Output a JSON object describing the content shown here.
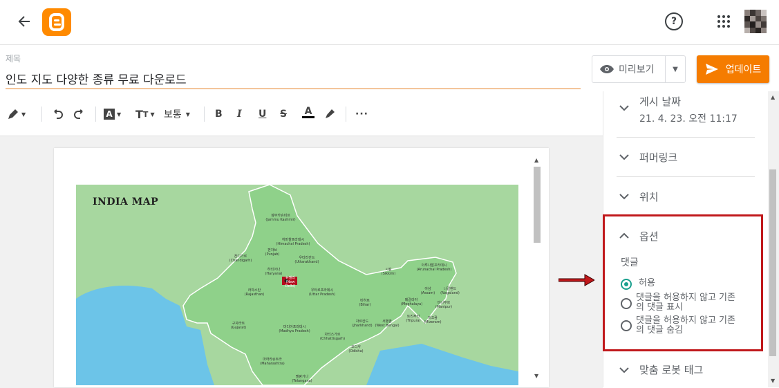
{
  "header": {
    "back_icon": "back-arrow-icon",
    "logo_icon": "blogger-logo-icon",
    "help_symbol": "?",
    "apps_icon": "apps-grid-icon",
    "avatar_icon": "user-avatar-icon",
    "brand_color": "#ff8a00"
  },
  "post": {
    "title_label": "제목",
    "title_value": "인도 지도 다양한 종류 무료 다운로드"
  },
  "actions": {
    "preview_label": "미리보기",
    "update_label": "업데이트",
    "update_color": "#f57c00"
  },
  "toolbar": {
    "paragraph_style": "보통"
  },
  "editor": {
    "map_title": "INDIA MAP",
    "map_labels": [
      "잠무카슈미르",
      "(Jammu Kashmir)",
      "히마찰프라데시",
      "(Himachal Pradesh)",
      "펀자브",
      "(Punjab)",
      "찬디가르",
      "(Chandigarh)",
      "우타라칸드",
      "(Uttarakhand)",
      "하리아나",
      "(Haryana)",
      "뉴델리",
      "(New Delhi)",
      "라자스탄",
      "(Rajasthan)",
      "우타르프라데시",
      "(Uttar Pradesh)",
      "비하르",
      "(Bihar)",
      "시킴",
      "(Sikkim)",
      "아루나찰프라데시",
      "(Arunachal Pradesh)",
      "아삼",
      "(Assam)",
      "나갈랜드",
      "(Nagaland)",
      "메갈라야",
      "(Meghalaya)",
      "마니푸르",
      "(Manipur)",
      "자르칸드",
      "(Jharkhand)",
      "서벵골",
      "(West Bengal)",
      "트리푸라",
      "(Tripura)",
      "미조람",
      "(Mizoram)",
      "구자라트",
      "(Gujarat)",
      "마디아프라데시",
      "(Madhya Pradesh)",
      "차티스가르",
      "(Chhattisgarh)",
      "오디샤",
      "(Odisha)",
      "마하라슈트라",
      "(Maharashtra)",
      "텔랑가나",
      "(Telangana)"
    ]
  },
  "sidebar": {
    "publish_title": "게시 날짜",
    "publish_value": "21. 4. 23. 오전 11:17",
    "permalink_title": "퍼머링크",
    "location_title": "위치",
    "options_title": "옵션",
    "comments_label": "댓글",
    "comment_options": [
      {
        "line1": "허용",
        "line2": "",
        "selected": true
      },
      {
        "line1": "댓글을 허용하지 않고 기존",
        "line2": "의 댓글 표시",
        "selected": false
      },
      {
        "line1": "댓글을 허용하지 않고 기존",
        "line2": "의 댓글 숨김",
        "selected": false
      }
    ],
    "robots_title": "맞춤 로봇 태그",
    "highlight_color": "#c0181b",
    "radio_color": "#1aa08e"
  }
}
